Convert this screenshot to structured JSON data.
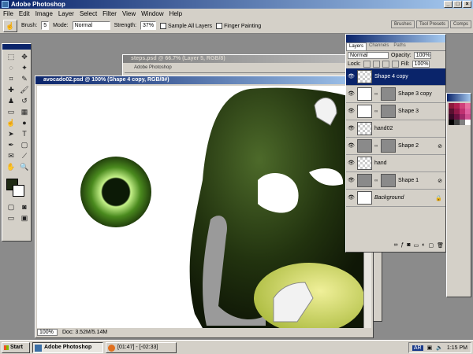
{
  "app": {
    "title": "Adobe Photoshop"
  },
  "menu": [
    "File",
    "Edit",
    "Image",
    "Layer",
    "Select",
    "Filter",
    "View",
    "Window",
    "Help"
  ],
  "options": {
    "brush_label": "Brush:",
    "brush_size": "5",
    "mode_label": "Mode:",
    "mode_value": "Normal",
    "strength_label": "Strength:",
    "strength_value": "37%",
    "sample_all_layers": "Sample All Layers",
    "finger_painting": "Finger Painting"
  },
  "palette_tabs": [
    "Brushes",
    "Tool Presets",
    "Comps"
  ],
  "steps_window": {
    "title": "steps.psd @ 66.7% (Layer 5, RGB/8)",
    "menu_text": "Adobe Photoshop"
  },
  "doc_window": {
    "title": "avocado02.psd @ 100% (Shape 4 copy, RGB/8#)",
    "zoom": "100%",
    "doc_info": "Doc: 3.52M/5.14M"
  },
  "layers_panel": {
    "tabs": [
      "Layers",
      "Channels",
      "Paths"
    ],
    "blend_mode": "Normal",
    "opacity_label": "Opacity:",
    "opacity_value": "100%",
    "lock_label": "Lock:",
    "fill_label": "Fill:",
    "fill_value": "100%",
    "layers": [
      {
        "name": "Shape 4 copy",
        "thumb": "checker",
        "selected": true
      },
      {
        "name": "Shape 3 copy",
        "thumb": "white",
        "selected": false
      },
      {
        "name": "Shape 3",
        "thumb": "white",
        "selected": false
      },
      {
        "name": "hand02",
        "thumb": "checker",
        "selected": false
      },
      {
        "name": "Shape 2",
        "thumb": "gray",
        "selected": false
      },
      {
        "name": "hand",
        "thumb": "checker",
        "selected": false
      },
      {
        "name": "Shape 1",
        "thumb": "gray",
        "selected": false
      },
      {
        "name": "Background",
        "thumb": "white",
        "selected": false
      }
    ]
  },
  "taskbar": {
    "start": "Start",
    "tasks": [
      "Adobe Photoshop",
      "[01:47] - [-02:33]"
    ],
    "tray_lang": "AR",
    "time": "1:15 PM"
  },
  "colors": {
    "foreground": "#1f2a14",
    "background": "#ffffff",
    "selection": "#0a246a"
  }
}
